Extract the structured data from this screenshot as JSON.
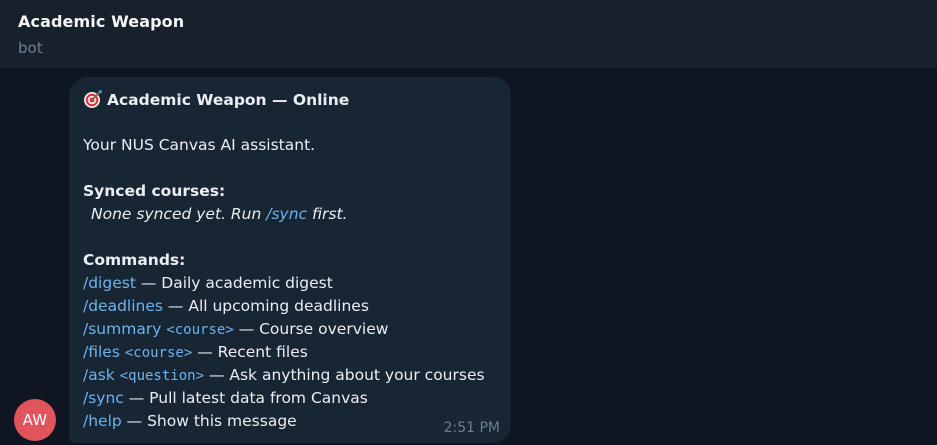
{
  "header": {
    "title": "Academic Weapon",
    "subtitle": "bot"
  },
  "avatar": {
    "initials": "AW",
    "color": "#e0545b"
  },
  "message": {
    "heading_icon": "target-icon",
    "heading": "Academic Weapon — Online",
    "intro": "Your NUS Canvas AI assistant.",
    "synced_label": "Synced courses:",
    "synced_note_before": "None synced yet. Run ",
    "synced_note_cmd": "/sync",
    "synced_note_after": " first.",
    "commands_label": "Commands:",
    "commands": [
      {
        "cmd": "/digest",
        "arg": "",
        "desc": " — Daily academic digest"
      },
      {
        "cmd": "/deadlines",
        "arg": "",
        "desc": " — All upcoming deadlines"
      },
      {
        "cmd": "/summary",
        "arg": "<course>",
        "desc": " — Course overview"
      },
      {
        "cmd": "/files",
        "arg": "<course>",
        "desc": " — Recent files"
      },
      {
        "cmd": "/ask",
        "arg": "<question>",
        "desc": " — Ask anything about your courses"
      },
      {
        "cmd": "/sync",
        "arg": "",
        "desc": " — Pull latest data from Canvas"
      },
      {
        "cmd": "/help",
        "arg": "",
        "desc": " — Show this message"
      }
    ],
    "time": "2:51 PM"
  },
  "colors": {
    "background": "#0e1621",
    "header": "#17212b",
    "bubble": "#182533",
    "link": "#6ab3f3",
    "muted": "#6d7f8f"
  }
}
